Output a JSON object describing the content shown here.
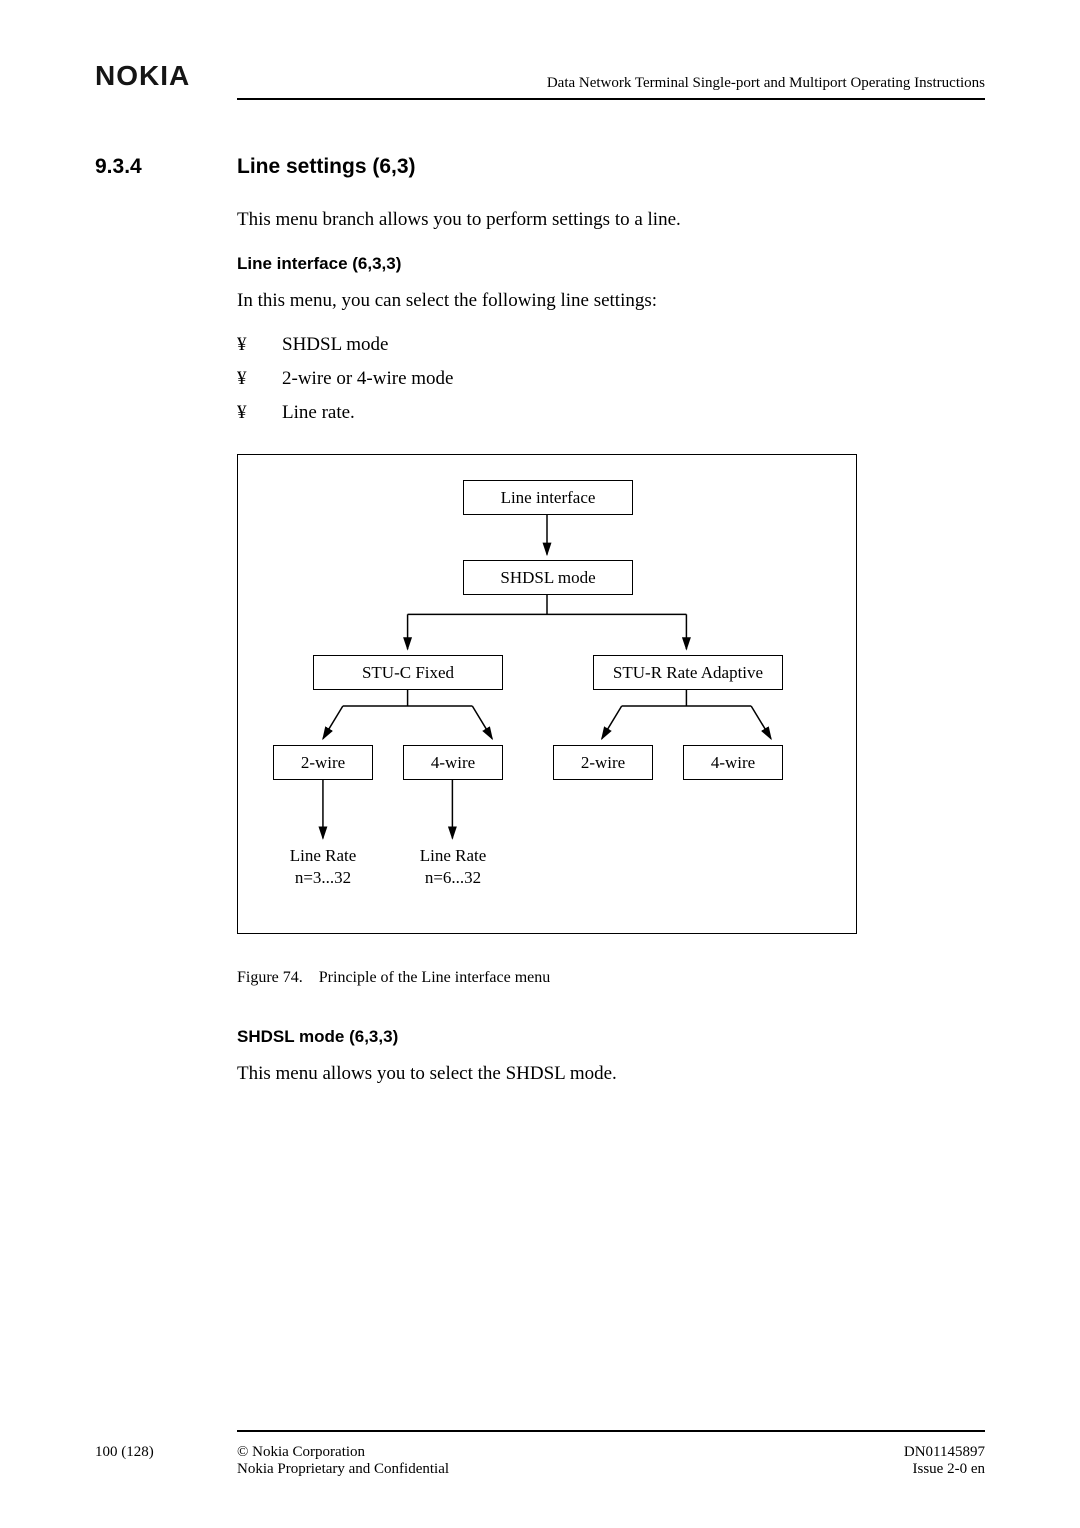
{
  "header": {
    "logo": "NOKIA",
    "doc_title": "Data Network Terminal Single-port and Multiport Operating Instructions"
  },
  "section": {
    "number": "9.3.4",
    "title": "Line settings (6,3)"
  },
  "intro": "This menu branch allows you to perform settings to a line.",
  "sub1": {
    "heading": "Line interface (6,3,3)",
    "intro": "In this menu, you can select the following line settings:",
    "bullets": [
      "SHDSL mode",
      "2-wire or 4-wire mode",
      "Line rate."
    ]
  },
  "diagram": {
    "line_interface": "Line interface",
    "shdsl_mode": "SHDSL mode",
    "stu_c": "STU-C Fixed",
    "stu_r": "STU-R Rate Adaptive",
    "two_wire_a": "2-wire",
    "four_wire_a": "4-wire",
    "two_wire_b": "2-wire",
    "four_wire_b": "4-wire",
    "line_rate_a1": "Line Rate",
    "line_rate_a2": "n=3...32",
    "line_rate_b1": "Line Rate",
    "line_rate_b2": "n=6...32"
  },
  "figure": {
    "label": "Figure 74.",
    "caption": "Principle of the Line interface menu"
  },
  "sub2": {
    "heading": "SHDSL mode (6,3,3)",
    "text": "This menu allows you to select the SHDSL mode."
  },
  "footer": {
    "page": "100 (128)",
    "copyright": "© Nokia Corporation",
    "confidential": "Nokia Proprietary and Confidential",
    "doc_id": "DN01145897",
    "issue": "Issue 2-0 en"
  },
  "bullet_char": "¥"
}
